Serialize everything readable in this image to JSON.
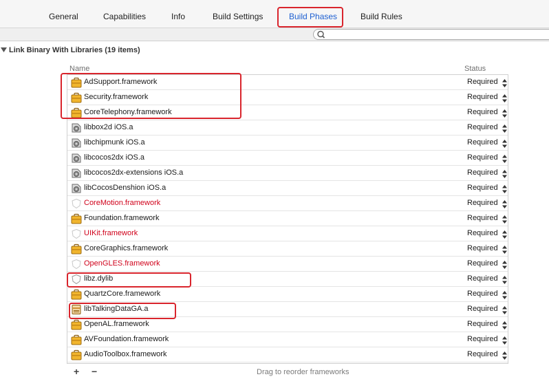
{
  "tabs": [
    {
      "label": "General",
      "active": false
    },
    {
      "label": "Capabilities",
      "active": false
    },
    {
      "label": "Info",
      "active": false
    },
    {
      "label": "Build Settings",
      "active": false
    },
    {
      "label": "Build Phases",
      "active": true
    },
    {
      "label": "Build Rules",
      "active": false
    }
  ],
  "section": {
    "title": "Link Binary With Libraries (19 items)"
  },
  "columns": {
    "name": "Name",
    "status": "Status"
  },
  "libraries": [
    {
      "name": "AdSupport.framework",
      "status": "Required",
      "icon": "framework-toolbox-icon",
      "missing": false
    },
    {
      "name": "Security.framework",
      "status": "Required",
      "icon": "framework-toolbox-icon",
      "missing": false
    },
    {
      "name": "CoreTelephony.framework",
      "status": "Required",
      "icon": "framework-toolbox-icon",
      "missing": false
    },
    {
      "name": "libbox2d iOS.a",
      "status": "Required",
      "icon": "static-library-icon",
      "missing": false
    },
    {
      "name": "libchipmunk iOS.a",
      "status": "Required",
      "icon": "static-library-icon",
      "missing": false
    },
    {
      "name": "libcocos2dx iOS.a",
      "status": "Required",
      "icon": "static-library-icon",
      "missing": false
    },
    {
      "name": "libcocos2dx-extensions iOS.a",
      "status": "Required",
      "icon": "static-library-icon",
      "missing": false
    },
    {
      "name": "libCocosDenshion iOS.a",
      "status": "Required",
      "icon": "static-library-icon",
      "missing": false
    },
    {
      "name": "CoreMotion.framework",
      "status": "Required",
      "icon": "missing-file-icon",
      "missing": true
    },
    {
      "name": "Foundation.framework",
      "status": "Required",
      "icon": "framework-toolbox-icon",
      "missing": false
    },
    {
      "name": "UIKit.framework",
      "status": "Required",
      "icon": "missing-file-icon",
      "missing": true
    },
    {
      "name": "CoreGraphics.framework",
      "status": "Required",
      "icon": "framework-toolbox-icon",
      "missing": false
    },
    {
      "name": "OpenGLES.framework",
      "status": "Required",
      "icon": "missing-file-icon",
      "missing": true
    },
    {
      "name": "libz.dylib",
      "status": "Required",
      "icon": "dylib-icon",
      "missing": false
    },
    {
      "name": "QuartzCore.framework",
      "status": "Required",
      "icon": "framework-toolbox-icon",
      "missing": false
    },
    {
      "name": "libTalkingDataGA.a",
      "status": "Required",
      "icon": "archive-library-icon",
      "missing": false
    },
    {
      "name": "OpenAL.framework",
      "status": "Required",
      "icon": "framework-toolbox-icon",
      "missing": false
    },
    {
      "name": "AVFoundation.framework",
      "status": "Required",
      "icon": "framework-toolbox-icon",
      "missing": false
    },
    {
      "name": "AudioToolbox.framework",
      "status": "Required",
      "icon": "framework-toolbox-icon",
      "missing": false
    }
  ],
  "footer": {
    "add_label": "+",
    "remove_label": "−",
    "hint": "Drag to reorder frameworks"
  },
  "colors": {
    "accent": "#1d5fd1",
    "highlight": "#d9242c",
    "missing": "#d0021b",
    "toolbox": "#e8a92a"
  }
}
